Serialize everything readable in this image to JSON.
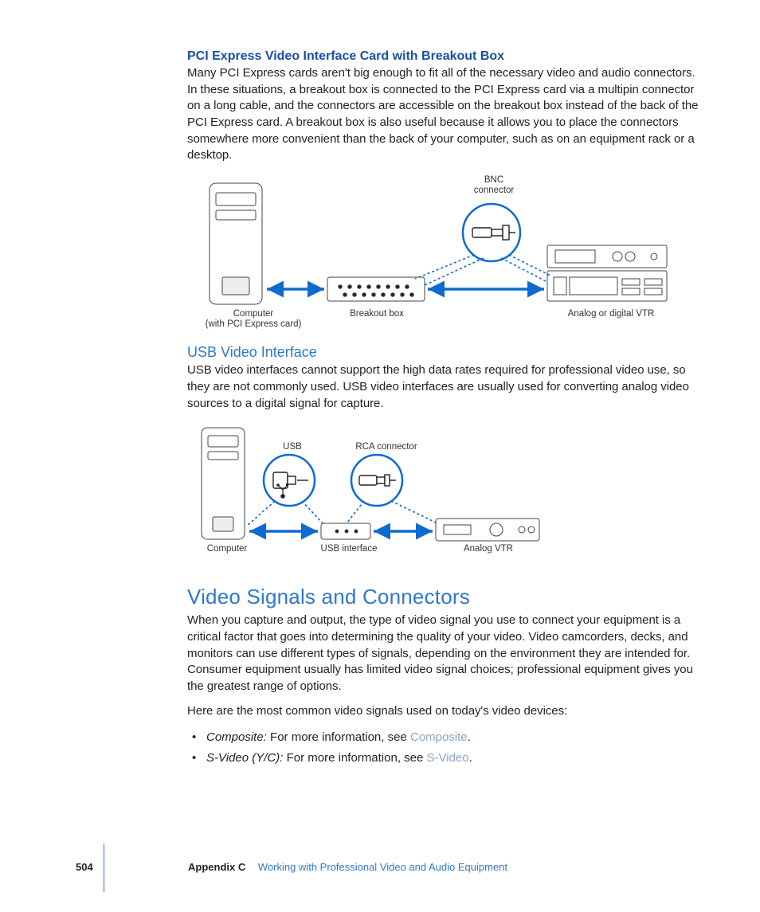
{
  "section1": {
    "title": "PCI Express Video Interface Card with Breakout Box",
    "para": "Many PCI Express cards aren't big enough to fit all of the necessary video and audio connectors. In these situations, a breakout box is connected to the PCI Express card via a multipin connector on a long cable, and the connectors are accessible on the breakout box instead of the back of the PCI Express card. A breakout box is also useful because it allows you to place the connectors somewhere more convenient than the back of your computer, such as on an equipment rack or a desktop."
  },
  "fig1": {
    "bnc_l1": "BNC",
    "bnc_l2": "connector",
    "computer_l1": "Computer",
    "computer_l2": "(with PCI Express card)",
    "breakout": "Breakout box",
    "vtr": "Analog or digital VTR"
  },
  "section2": {
    "title": "USB Video Interface",
    "para": "USB video interfaces cannot support the high data rates required for professional video use, so they are not commonly used. USB video interfaces are usually used for converting analog video sources to a digital signal for capture."
  },
  "fig2": {
    "usb": "USB",
    "rca": "RCA connector",
    "computer": "Computer",
    "usbif": "USB interface",
    "avtr": "Analog VTR"
  },
  "section3": {
    "title": "Video Signals and Connectors",
    "para1": "When you capture and output, the type of video signal you use to connect your equipment is a critical factor that goes into determining the quality of your video. Video camcorders, decks, and monitors can use different types of signals, depending on the environment they are intended for. Consumer equipment usually has limited video signal choices; professional equipment gives you the greatest range of options.",
    "para2": "Here are the most common video signals used on today's video devices:",
    "bullets": [
      {
        "label": "Composite:",
        "text": "  For more information, see ",
        "link": "Composite"
      },
      {
        "label": "S-Video (Y/C):",
        "text": "  For more information, see ",
        "link": "S-Video"
      }
    ]
  },
  "footer": {
    "page": "504",
    "appendix": "Appendix C",
    "title": "Working with Professional Video and Audio Equipment"
  }
}
